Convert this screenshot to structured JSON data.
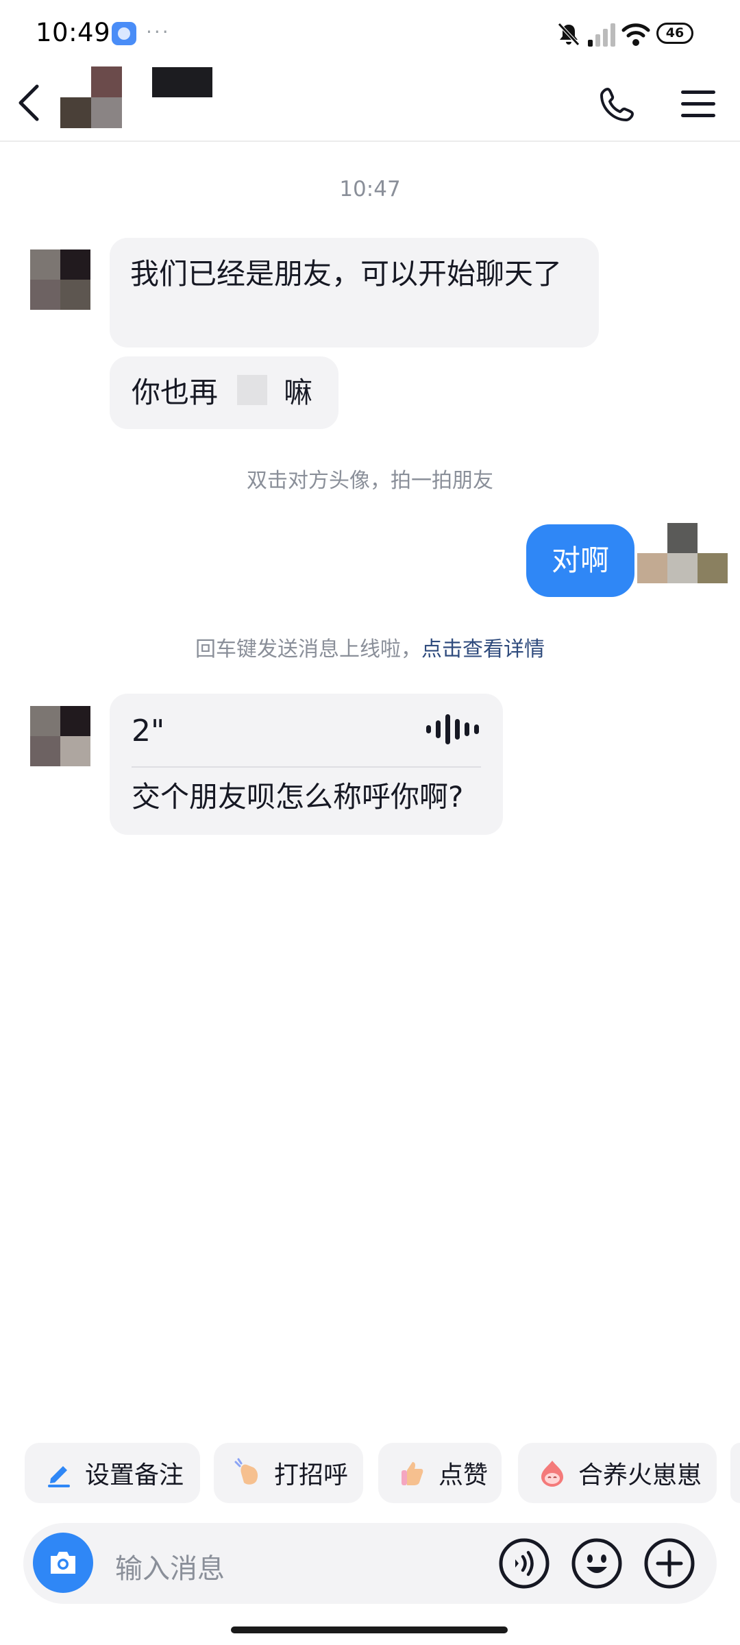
{
  "status_bar": {
    "time": "10:49",
    "battery": "46"
  },
  "header": {
    "back_icon": "chevron-left-icon",
    "call_icon": "phone-icon",
    "menu_icon": "menu-icon"
  },
  "chat": {
    "timestamp": "10:47",
    "messages": [
      {
        "from": "other",
        "text": "我们已经是朋友，可以开始聊天了"
      },
      {
        "from": "other",
        "text_before": "你也再",
        "text_after": "嘛"
      },
      {
        "from": "me",
        "text": "对啊"
      }
    ],
    "system_tip_pat": "双击对方头像，拍一拍朋友",
    "system_tip_enter": "回车键发送消息上线啦，",
    "system_tip_link": "点击查看详情",
    "voice_message": {
      "duration": "2\"",
      "transcript": "交个朋友呗怎么称呼你啊?"
    }
  },
  "quick_actions": [
    {
      "label": "设置备注",
      "icon": "pencil-icon"
    },
    {
      "label": "打招呼",
      "icon": "wave-hand-icon"
    },
    {
      "label": "点赞",
      "icon": "thumbs-up-icon"
    },
    {
      "label": "合养火崽崽",
      "icon": "fire-pet-icon"
    }
  ],
  "input": {
    "placeholder": "输入消息"
  },
  "colors": {
    "accent": "#2f87f6",
    "bubble_other": "#f3f3f5",
    "link": "#2f4b7d"
  }
}
